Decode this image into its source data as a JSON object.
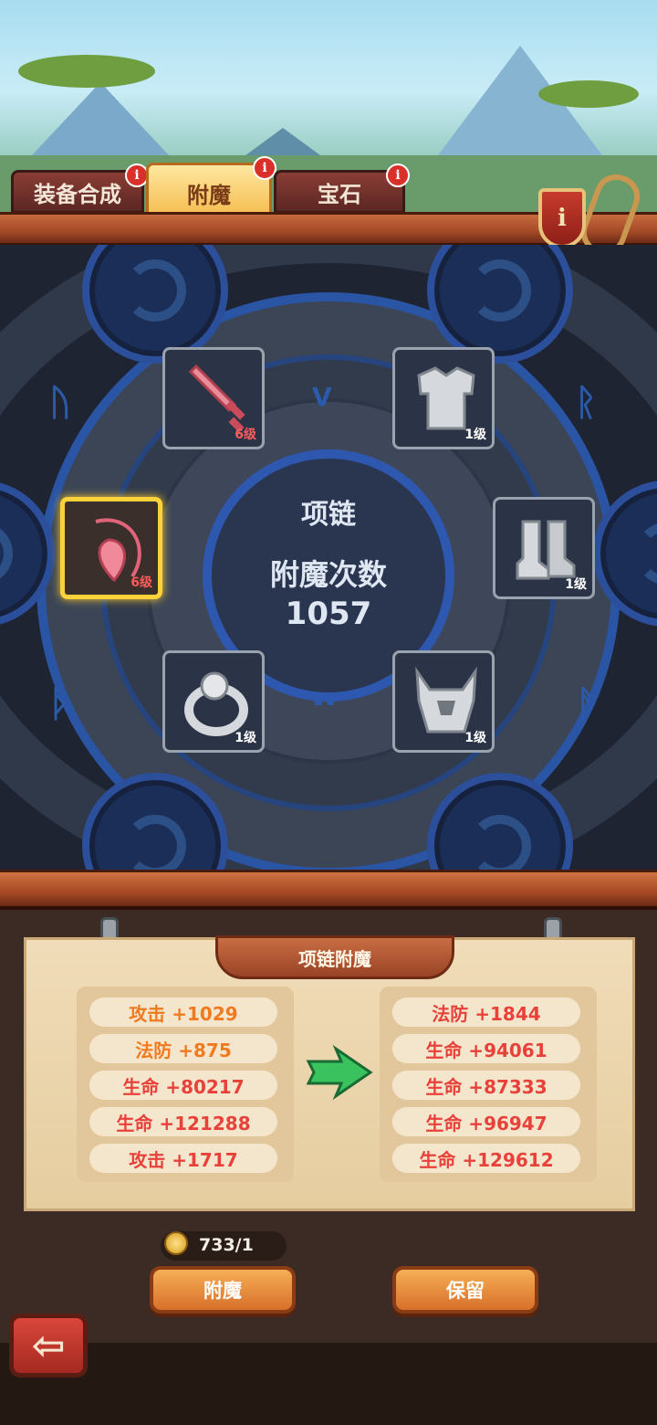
{
  "tabs": [
    {
      "label": "装备合成",
      "badge": "i",
      "active": false
    },
    {
      "label": "附魔",
      "badge": "i",
      "active": true
    },
    {
      "label": "宝石",
      "badge": "i",
      "active": false
    }
  ],
  "info_button": {
    "label": "i"
  },
  "equipment_slots": {
    "sword": {
      "icon": "sword-icon",
      "level": "6级"
    },
    "necklace": {
      "icon": "necklace-icon",
      "level": "6级",
      "selected": true
    },
    "armor": {
      "icon": "armor-icon",
      "level": "1级"
    },
    "boots": {
      "icon": "boots-icon",
      "level": "1级"
    },
    "ring": {
      "icon": "ring-icon",
      "level": "1级"
    },
    "helmet": {
      "icon": "helmet-icon",
      "level": "1级"
    }
  },
  "center": {
    "title": "项链",
    "subtitle": "附魔次数",
    "count": "1057"
  },
  "panel": {
    "title": "项链附魔",
    "current_stats": [
      {
        "text": "攻击 +1029",
        "color": "#f07a1f"
      },
      {
        "text": "法防 +875",
        "color": "#f07a1f"
      },
      {
        "text": "生命 +80217",
        "color": "#e8413a"
      },
      {
        "text": "生命 +121288",
        "color": "#e8413a"
      },
      {
        "text": "攻击 +1717",
        "color": "#e8413a"
      }
    ],
    "new_stats": [
      {
        "text": "法防 +1844",
        "color": "#e8413a"
      },
      {
        "text": "生命 +94061",
        "color": "#e8413a"
      },
      {
        "text": "生命 +87333",
        "color": "#e8413a"
      },
      {
        "text": "生命 +96947",
        "color": "#e8413a"
      },
      {
        "text": "生命 +129612",
        "color": "#e8413a"
      }
    ]
  },
  "cost": {
    "value": "733/1",
    "icon": "gold-coin-icon"
  },
  "buttons": {
    "enchant": "附魔",
    "keep": "保留"
  },
  "back": {
    "icon": "back-arrow-icon"
  },
  "colors": {
    "accent": "#f3b949",
    "selected_border": "#ffd23a",
    "wood": "#a44a27"
  }
}
